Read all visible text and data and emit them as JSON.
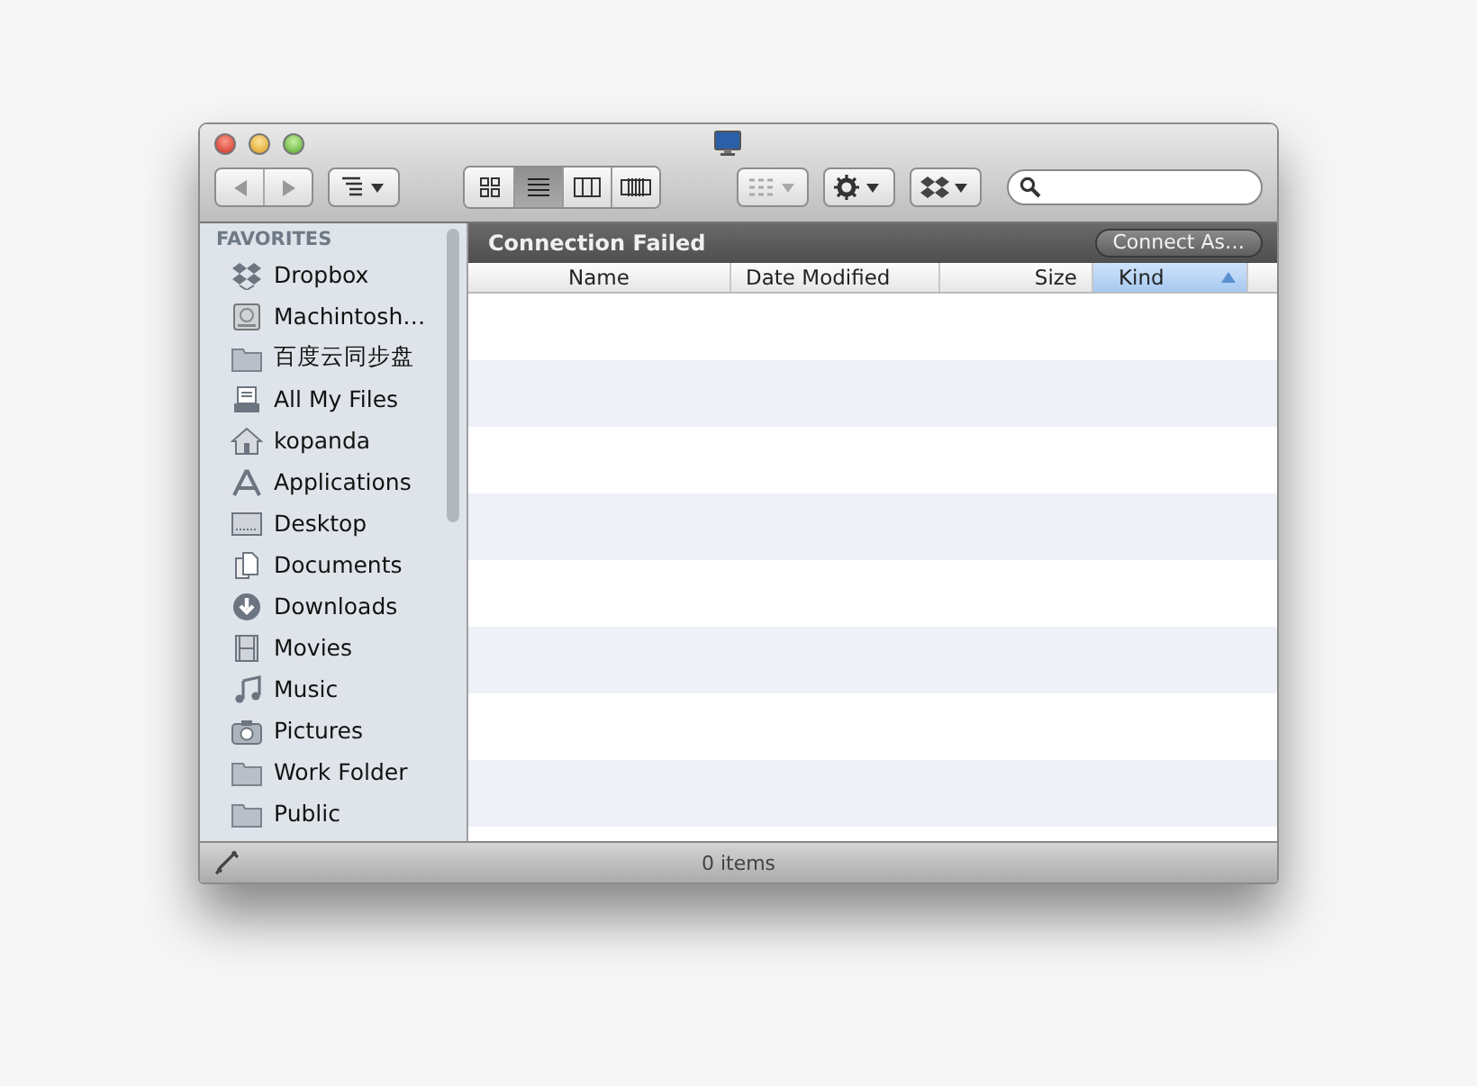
{
  "toolbar": {
    "view_modes": [
      {
        "selected": false
      },
      {
        "selected": true
      },
      {
        "selected": false
      },
      {
        "selected": false
      }
    ],
    "arrange_disabled": true
  },
  "sidebar": {
    "heading": "FAVORITES",
    "items": [
      {
        "label": "Dropbox",
        "selected": false
      },
      {
        "label": "Machintosh…",
        "selected": false
      },
      {
        "label": "百度云同步盘",
        "selected": false
      },
      {
        "label": "All My Files",
        "selected": false
      },
      {
        "label": "kopanda",
        "selected": false
      },
      {
        "label": "Applications",
        "selected": false
      },
      {
        "label": "Desktop",
        "selected": false
      },
      {
        "label": "Documents",
        "selected": false
      },
      {
        "label": "Downloads",
        "selected": false
      },
      {
        "label": "Movies",
        "selected": false
      },
      {
        "label": "Music",
        "selected": false
      },
      {
        "label": "Pictures",
        "selected": false
      },
      {
        "label": "Work Folder",
        "selected": false
      },
      {
        "label": "Public",
        "selected": false
      }
    ]
  },
  "banner": {
    "message": "Connection Failed",
    "button": "Connect As…"
  },
  "table": {
    "columns": [
      {
        "label": "Name",
        "selected": false
      },
      {
        "label": "Date Modified",
        "selected": false
      },
      {
        "label": "Size",
        "selected": false
      },
      {
        "label": "Kind",
        "selected": true
      }
    ]
  },
  "status_bar": {
    "text": "0 items"
  }
}
